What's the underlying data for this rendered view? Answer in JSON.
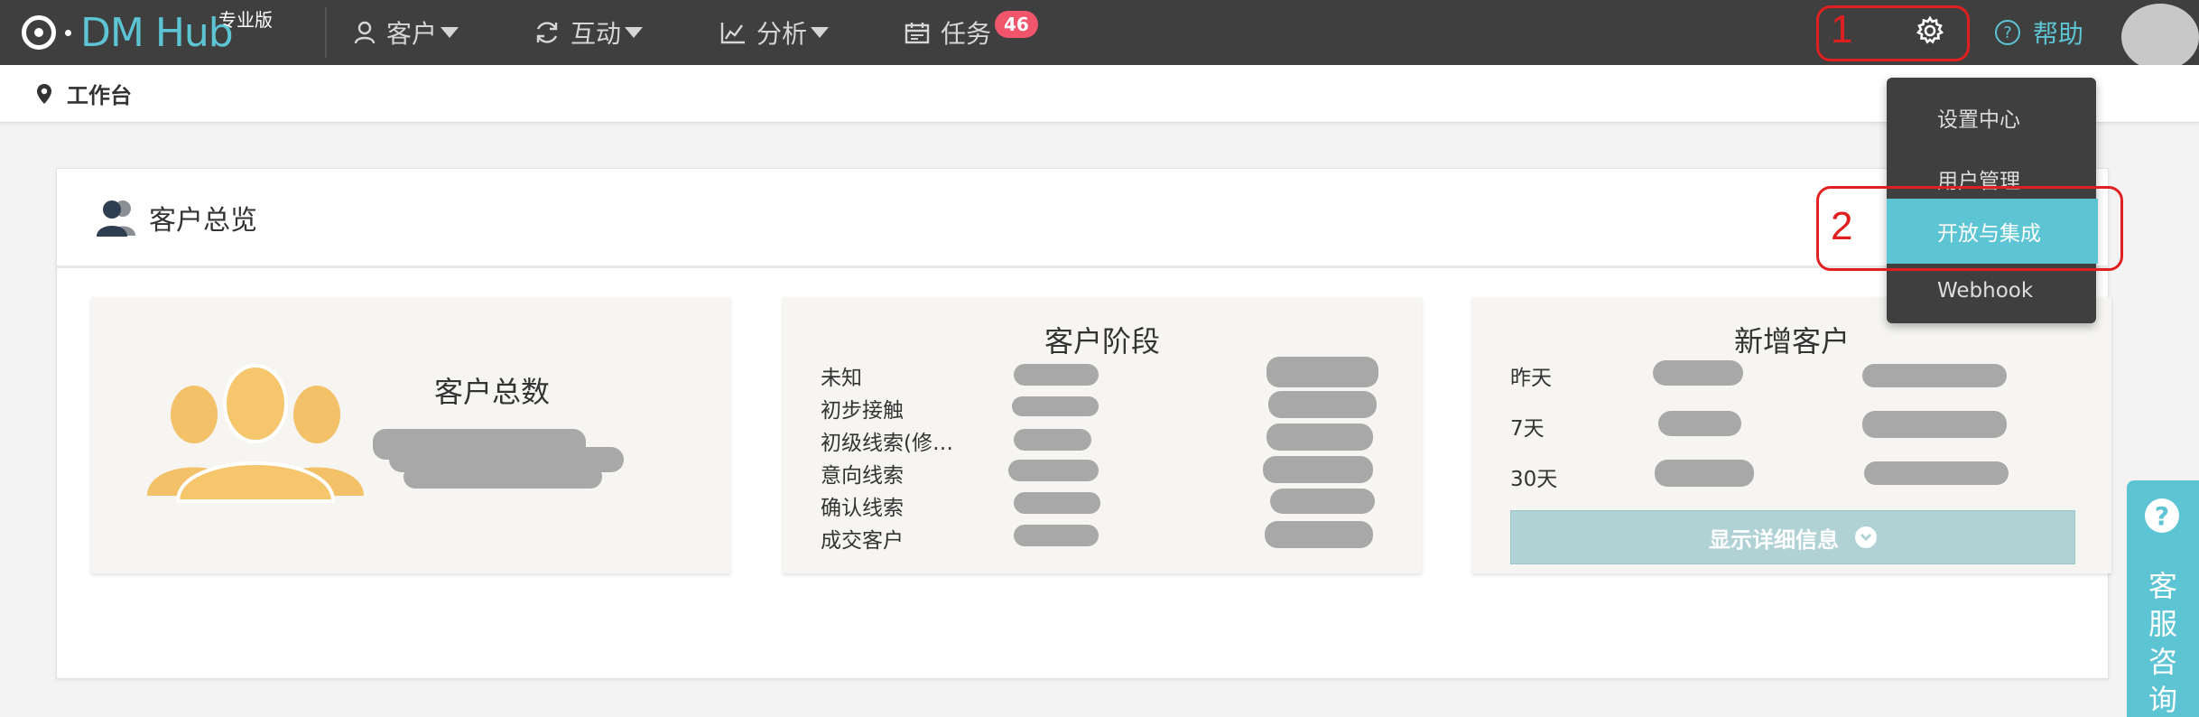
{
  "brand": {
    "name": "DM Hub",
    "edition": "专业版",
    "accent_color": "#5cc4d3"
  },
  "nav": {
    "items": [
      {
        "label": "客户",
        "icon": "person-icon"
      },
      {
        "label": "互动",
        "icon": "refresh-icon"
      },
      {
        "label": "分析",
        "icon": "chart-icon"
      },
      {
        "label": "任务",
        "icon": "calendar-icon"
      }
    ],
    "tasks_badge": "46",
    "help_label": "帮助"
  },
  "breadcrumb": {
    "label": "工作台"
  },
  "overview": {
    "title": "客户总览",
    "total": {
      "title": "客户总数"
    },
    "stages": {
      "title": "客户阶段",
      "rows": [
        "未知",
        "初步接触",
        "初级线索(修…",
        "意向线索",
        "确认线索",
        "成交客户"
      ]
    },
    "new_customers": {
      "title": "新增客户",
      "rows": [
        "昨天",
        "7天",
        "30天"
      ],
      "detail_button": "显示详细信息"
    }
  },
  "settings_menu": {
    "items": [
      "设置中心",
      "用户管理",
      "开放与集成",
      "Webhook"
    ],
    "active_index": 2
  },
  "annotations": {
    "step1": "1",
    "step2": "2",
    "color": "#e02020"
  },
  "side_widget": {
    "label": "客服咨询",
    "chars": [
      "客",
      "服",
      "咨",
      "询"
    ]
  }
}
